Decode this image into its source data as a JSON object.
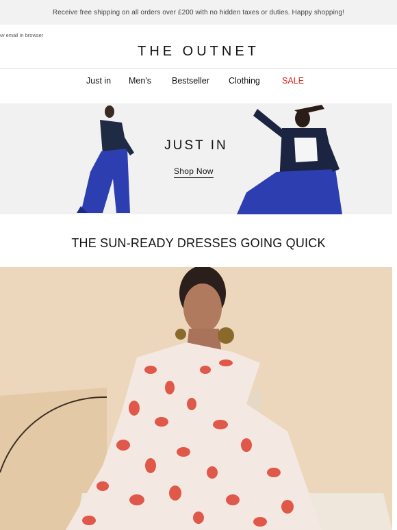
{
  "top_banner": {
    "text": "Receive free shipping on all orders over £200 with no hidden taxes or duties. Happy shopping!"
  },
  "browser_link": "ew email in browser",
  "brand": {
    "logo": "THE OUTNET"
  },
  "nav": {
    "items": [
      {
        "label": "Just in"
      },
      {
        "label": "Men's"
      },
      {
        "label": "Bestseller"
      },
      {
        "label": "Clothing"
      },
      {
        "label": "SALE"
      }
    ]
  },
  "hero": {
    "title": "JUST IN",
    "cta": "Shop Now"
  },
  "section": {
    "title": "THE SUN-READY DRESSES GOING QUICK"
  },
  "colors": {
    "sale": "#e2231a",
    "topbar_bg": "#f2f2f2",
    "feature_bg": "#ecd7bc",
    "accent_blue": "#2d3fb0"
  }
}
